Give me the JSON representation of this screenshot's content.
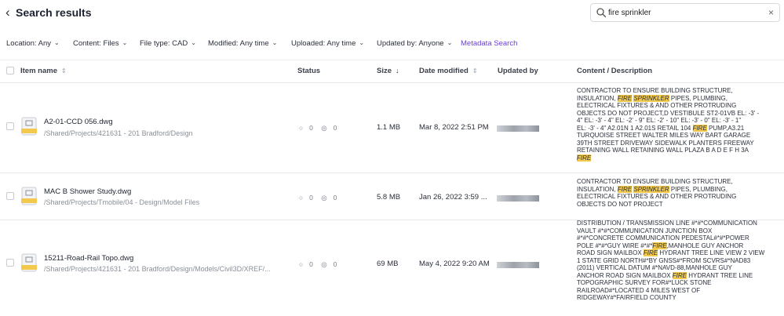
{
  "header": {
    "back_icon": "‹",
    "title": "Search results",
    "search": {
      "value": "fire sprinkler",
      "clear_icon": "×"
    }
  },
  "filters": [
    {
      "label": "Location: Any"
    },
    {
      "label": "Content: Files"
    },
    {
      "label": "File type: CAD"
    },
    {
      "label": "Modified: Any time"
    },
    {
      "label": "Uploaded: Any time"
    },
    {
      "label": "Updated by: Anyone"
    }
  ],
  "metadata_search": "Metadata Search",
  "columns": {
    "item_name": "Item name",
    "status": "Status",
    "size": "Size",
    "date_modified": "Date modified",
    "updated_by": "Updated by",
    "content": "Content / Description"
  },
  "rows": [
    {
      "name": "A2-01-CCD 056.dwg",
      "path": "/Shared/Projects/421631 - 201 Bradford/Design",
      "comments": "0",
      "views": "0",
      "size": "1.1 MB",
      "date": "Mar 8, 2022 2:51 PM",
      "content": [
        "CONTRACTOR TO ENSURE BUILDING STRUCTURE,",
        "INSULATION, ",
        "FIRE",
        " ",
        "SPRINKLER",
        " PIPES, PLUMBING,",
        "ELECTRICAL FIXTURES & AND OTHER PROTRUDING",
        "OBJECTS DO NOT PROJECT,D VESTIBULE ST2-01VB EL: -3' -",
        "4\" EL: -3' - 4\" EL: -2' - 9\" EL: -2' - 10\" EL: -3' - 0\" EL: -3' - 1\"",
        "EL: -3' - 4\" A2.01N 1 A2.01S RETAIL 104 ",
        "FIRE",
        " PUMP,A3.21",
        "TURQUOISE STREET WALTER MILES WAY BART GARAGE",
        "39TH STREET DRIVEWAY SIDEWALK PLANTERS FREEWAY",
        "RETAINING WALL RETAINING WALL PLAZA B A D E F H 3A",
        "FIRE"
      ]
    },
    {
      "name": "MAC B Shower Study.dwg",
      "path": "/Shared/Projects/Tmobile/04 - Design/Model Files",
      "comments": "0",
      "views": "0",
      "size": "5.8 MB",
      "date": "Jan 26, 2022 3:59 ...",
      "content": [
        "CONTRACTOR TO ENSURE BUILDING STRUCTURE,",
        "INSULATION, ",
        "FIRE",
        " ",
        "SPRINKLER",
        " PIPES, PLUMBING,",
        "ELECTRICAL FIXTURES & AND OTHER PROTRUDING",
        "OBJECTS DO NOT PROJECT"
      ]
    },
    {
      "name": "15211-Road-Rail Topo.dwg",
      "path": "/Shared/Projects/421631 - 201 Bradford/Design/Models/Civil3D/XREF/...",
      "comments": "0",
      "views": "0",
      "size": "69 MB",
      "date": "May 4, 2022 9:20 AM",
      "content": [
        "DISTRIBUTION / TRANSMISSION LINE #*#*COMMUNICATION",
        "VAULT #*#*COMMUNICATION JUNCTION BOX",
        "#*#*CONCRETE COMMUNICATION PEDESTAL#*#*POWER",
        "POLE #*#*GUY WIRE #*#*",
        "FIRE",
        ",MANHOLE GUY ANCHOR",
        "ROAD SIGN MAILBOX ",
        "FIRE",
        " HYDRANT TREE LINE VIEW 2 VIEW",
        "1 STATE GRID NORTH#*BY GNSS#*FROM SCVRS#*NAD83",
        "(2011) VERTICAL DATUM #*NAVD-88,MANHOLE GUY",
        "ANCHOR ROAD SIGN MAILBOX ",
        "FIRE",
        " HYDRANT TREE LINE",
        "TOPOGRAPHIC SURVEY FOR#*LUCK STONE",
        "RAILROAD#*LOCATED 4 MILES WEST OF",
        "RIDGEWAY#*FAIRFIELD COUNTY"
      ]
    }
  ],
  "file_badge": "DWG",
  "colors": {
    "accent": "#6b3fd4",
    "highlight": "#f2c94c",
    "file_badge": "#f2c94c"
  }
}
